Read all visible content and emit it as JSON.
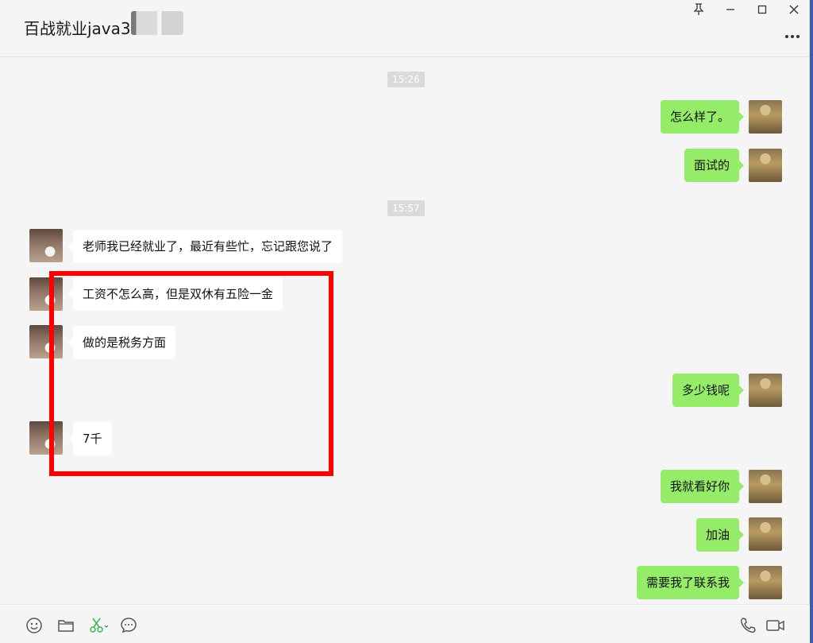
{
  "header": {
    "title": "百战就业java3",
    "controls": {
      "pin": "pin-icon",
      "minimize": "minimize-icon",
      "maximize": "maximize-icon",
      "close": "close-icon"
    },
    "more": "more-icon"
  },
  "timestamps": [
    "15:26",
    "15:57"
  ],
  "messages": [
    {
      "from": "me",
      "text": "怎么样了。"
    },
    {
      "from": "me",
      "text": "面试的"
    },
    {
      "from": "them",
      "text": "老师我已经就业了，最近有些忙，忘记跟您说了"
    },
    {
      "from": "them",
      "text": "工资不怎么高，但是双休有五险一金"
    },
    {
      "from": "them",
      "text": "做的是税务方面"
    },
    {
      "from": "me",
      "text": "多少钱呢"
    },
    {
      "from": "them",
      "text": "7千"
    },
    {
      "from": "me",
      "text": "我就看好你"
    },
    {
      "from": "me",
      "text": "加油"
    },
    {
      "from": "me",
      "text": "需要我了联系我"
    }
  ],
  "toolbar": {
    "left": [
      "emoji-icon",
      "folder-icon",
      "scissors-icon",
      "chat-bubble-icon"
    ],
    "right": [
      "phone-icon",
      "video-icon"
    ]
  },
  "colors": {
    "my_bubble": "#95ec69",
    "their_bubble": "#ffffff",
    "highlight_box": "#ff0000",
    "background": "#f5f5f5"
  }
}
